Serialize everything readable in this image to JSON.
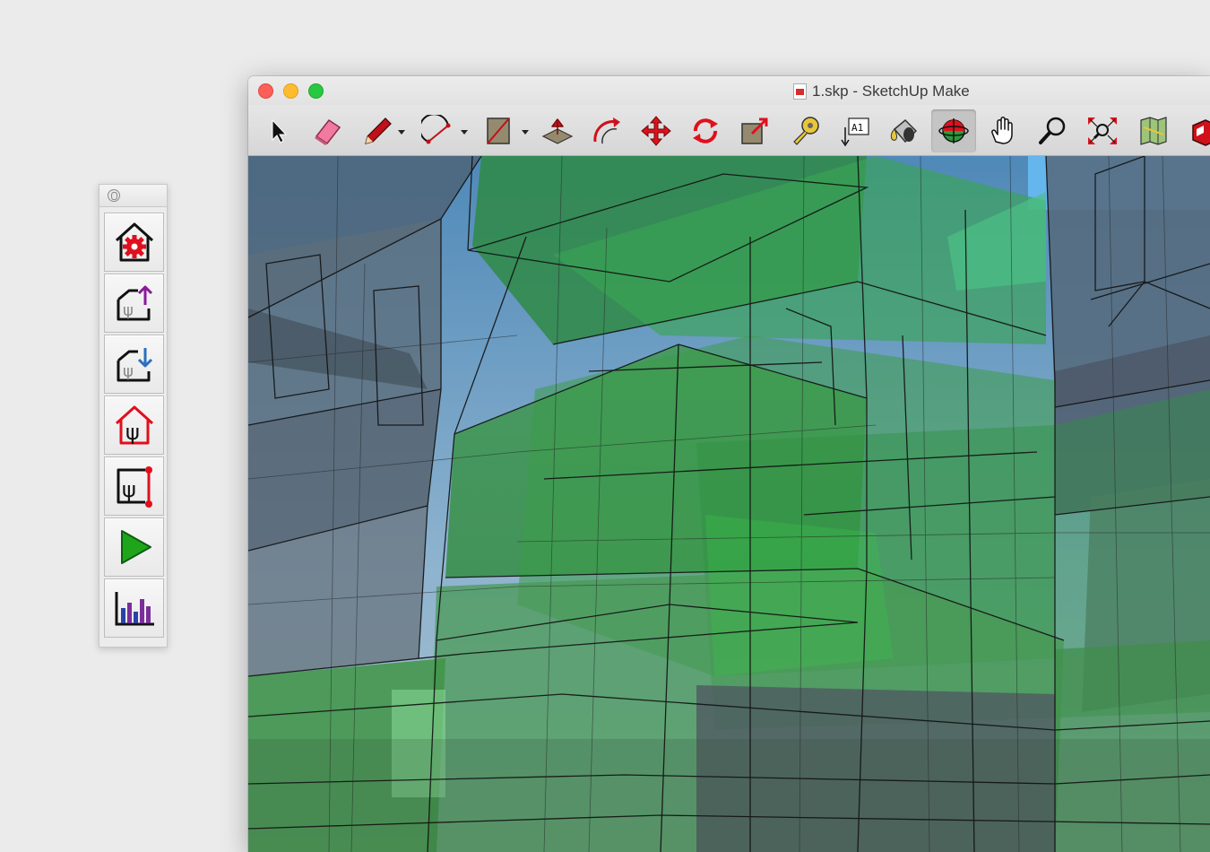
{
  "window": {
    "title": "1.skp - SketchUp Make"
  },
  "toolbar": {
    "tools": [
      {
        "name": "select",
        "icon": "arrow-pointer-icon"
      },
      {
        "name": "eraser",
        "icon": "eraser-icon"
      },
      {
        "name": "line",
        "icon": "pencil-icon",
        "has_dropdown": true
      },
      {
        "name": "arc",
        "icon": "arc-icon",
        "has_dropdown": true
      },
      {
        "name": "rectangle",
        "icon": "rectangle-icon",
        "has_dropdown": true
      },
      {
        "name": "push-pull",
        "icon": "push-pull-icon"
      },
      {
        "name": "offset",
        "icon": "offset-icon"
      },
      {
        "name": "move",
        "icon": "move-icon"
      },
      {
        "name": "rotate",
        "icon": "rotate-icon"
      },
      {
        "name": "scale",
        "icon": "scale-icon"
      },
      {
        "name": "tape-measure",
        "icon": "tape-measure-icon"
      },
      {
        "name": "text",
        "icon": "text-icon",
        "label": "A1"
      },
      {
        "name": "paint-bucket",
        "icon": "paint-bucket-icon"
      },
      {
        "name": "orbit",
        "icon": "orbit-icon",
        "active": true
      },
      {
        "name": "pan",
        "icon": "hand-icon"
      },
      {
        "name": "zoom",
        "icon": "magnifier-icon"
      },
      {
        "name": "zoom-extents",
        "icon": "zoom-extents-icon"
      },
      {
        "name": "add-location",
        "icon": "map-icon"
      },
      {
        "name": "warehouse",
        "icon": "warehouse-icon"
      }
    ]
  },
  "palette": {
    "buttons": [
      {
        "name": "settings",
        "icon": "house-gear-icon"
      },
      {
        "name": "export",
        "icon": "house-export-icon"
      },
      {
        "name": "import",
        "icon": "house-import-icon"
      },
      {
        "name": "psi-house",
        "icon": "house-psi-icon"
      },
      {
        "name": "psi-line",
        "icon": "psi-line-icon"
      },
      {
        "name": "run",
        "icon": "play-icon"
      },
      {
        "name": "results",
        "icon": "bar-chart-icon"
      }
    ]
  },
  "colors": {
    "accent_red": "#e0101c",
    "green_tool": "#2aa81e",
    "bar_purple": "#7a2e9b",
    "bar_blue": "#2b43a8",
    "sky": "#5fa4d6",
    "glass_green": "#3fae4f"
  }
}
